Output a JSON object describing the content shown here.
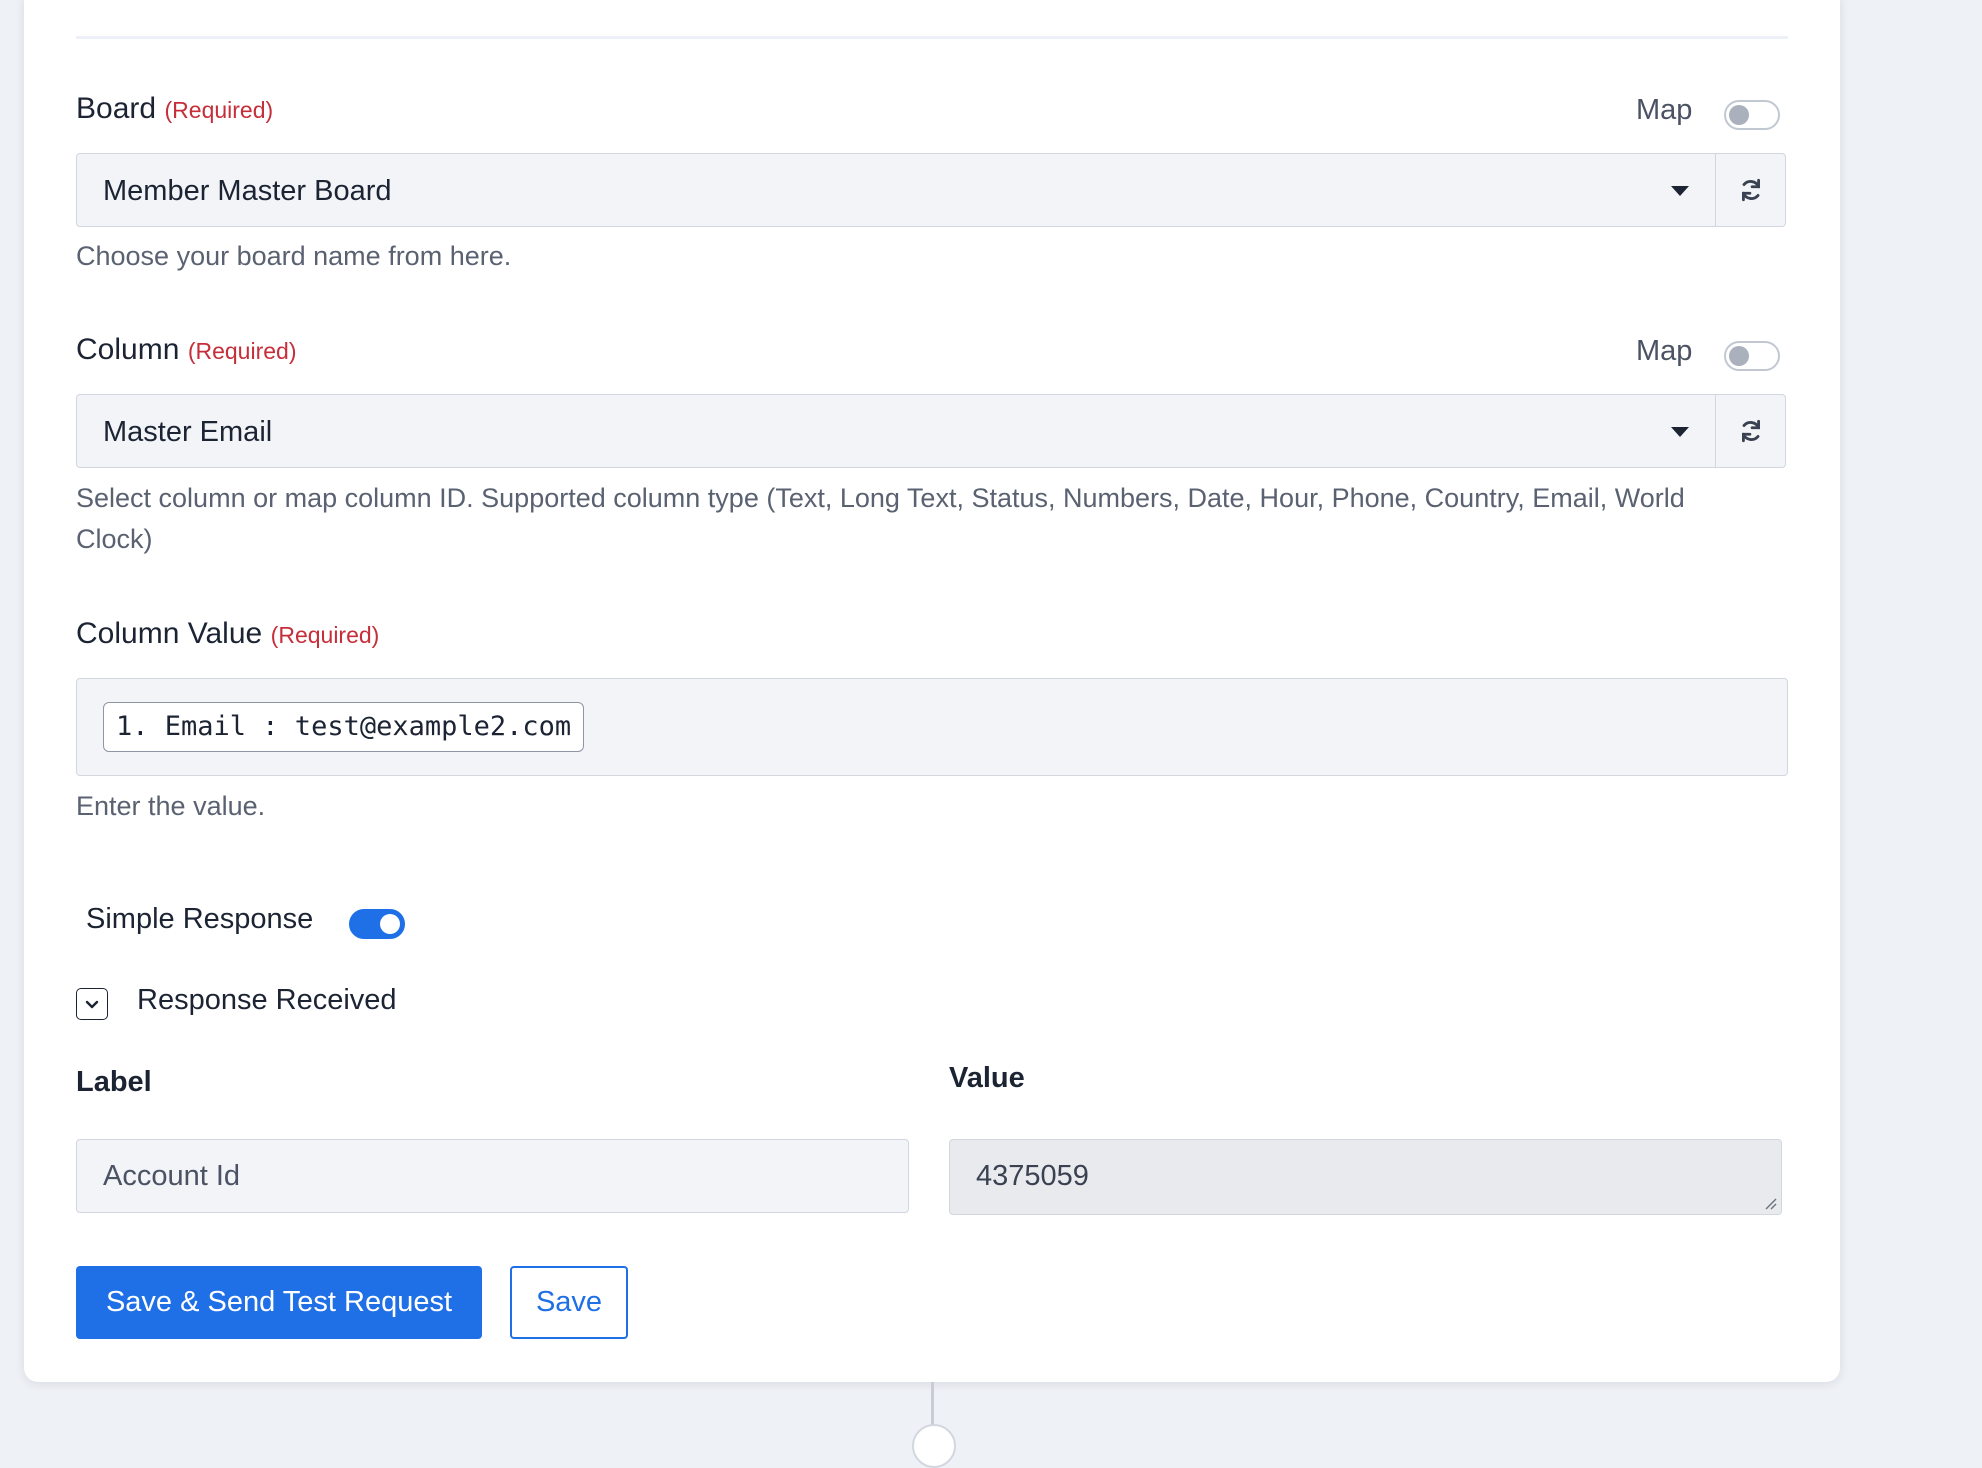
{
  "board": {
    "label": "Board",
    "required": "(Required)",
    "map_label": "Map",
    "map_enabled": false,
    "selected": "Member Master Board",
    "help": "Choose your board name from here."
  },
  "column": {
    "label": "Column",
    "required": "(Required)",
    "map_label": "Map",
    "map_enabled": false,
    "selected": "Master Email",
    "help": "Select column or map column ID. Supported column type (Text, Long Text, Status, Numbers, Date, Hour, Phone, Country, Email, World",
    "help_line2": "Clock)"
  },
  "column_value": {
    "label": "Column Value",
    "required": "(Required)",
    "chip": "1. Email : test@example2.com",
    "help": "Enter the value."
  },
  "simple_response": {
    "label": "Simple Response",
    "enabled": true
  },
  "response_received": {
    "label": "Response Received",
    "label_header": "Label",
    "value_header": "Value",
    "row_label": "Account Id",
    "row_value": "4375059"
  },
  "buttons": {
    "save_send": "Save & Send Test Request",
    "save": "Save"
  },
  "colors": {
    "primary": "#1f6fe6",
    "required": "#c62f3a"
  }
}
